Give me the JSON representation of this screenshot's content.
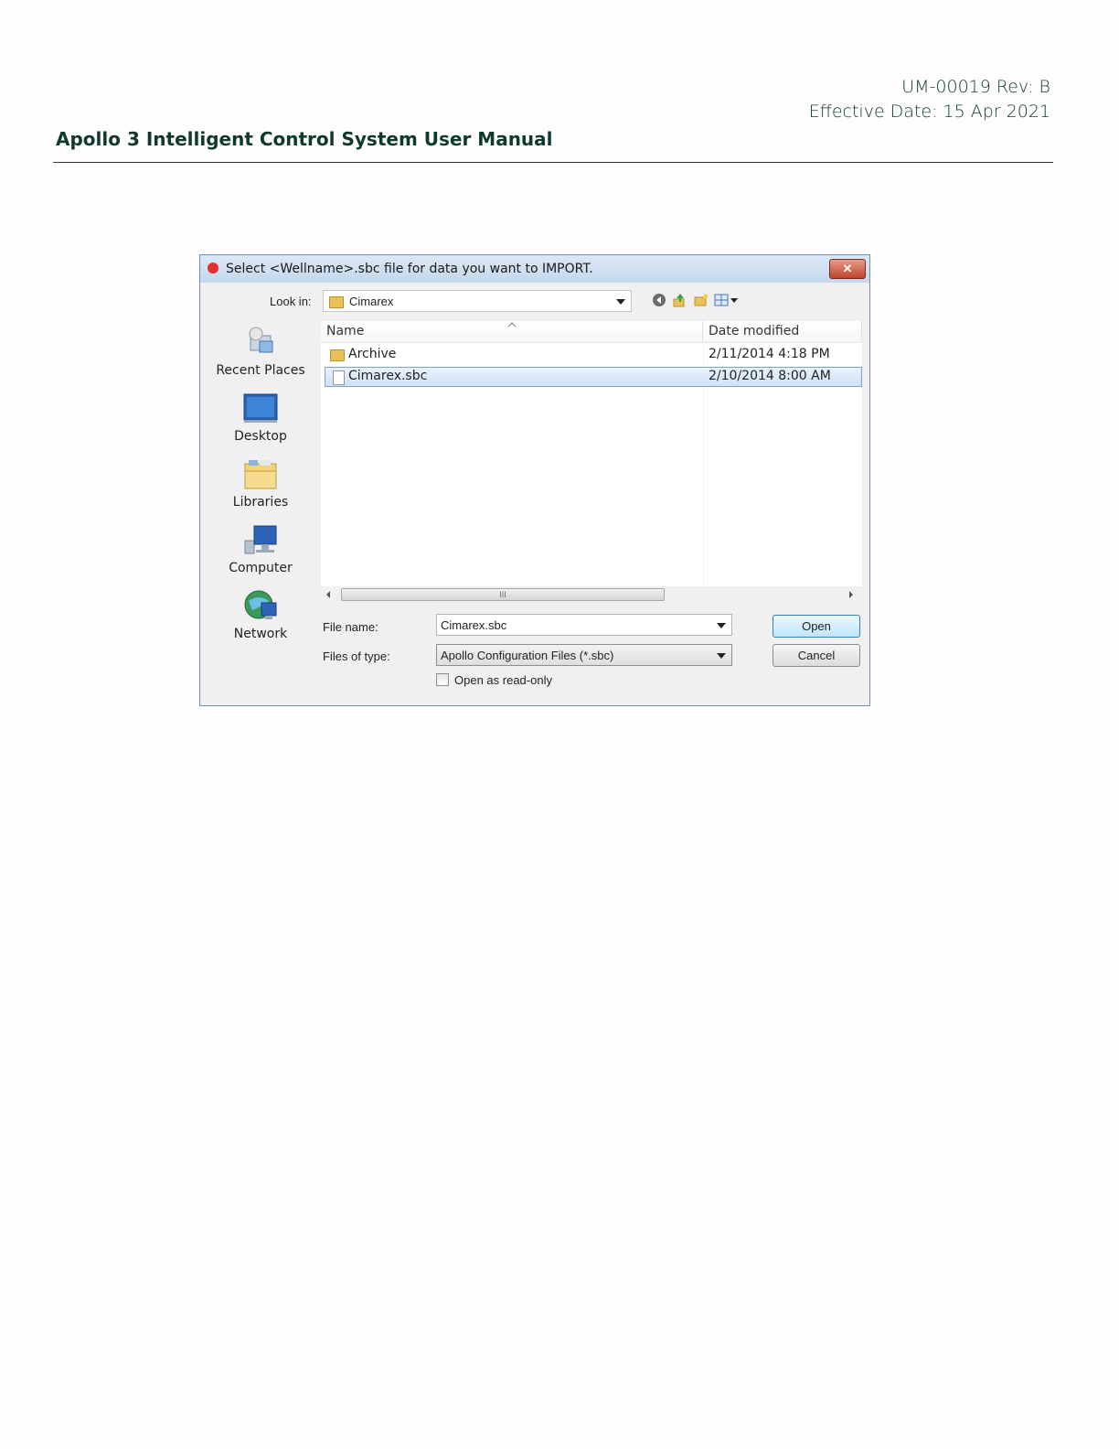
{
  "document": {
    "doc_number": "UM-00019  Rev:  B",
    "effective_date": "Effective Date: 15 Apr 2021",
    "manual_title": "Apollo 3 Intelligent Control System User Manual"
  },
  "dialog": {
    "title": "Select <Wellname>.sbc file for data you want to IMPORT.",
    "close_label": "✕",
    "look_in_label": "Look in:",
    "look_in_value": "Cimarex",
    "toolbar_icons": [
      "back-icon",
      "up-folder-icon",
      "new-folder-icon",
      "view-menu-icon"
    ],
    "places": [
      {
        "label": "Recent Places",
        "icon": "recent-places-icon"
      },
      {
        "label": "Desktop",
        "icon": "desktop-icon"
      },
      {
        "label": "Libraries",
        "icon": "libraries-icon"
      },
      {
        "label": "Computer",
        "icon": "computer-icon"
      },
      {
        "label": "Network",
        "icon": "network-icon"
      }
    ],
    "columns": {
      "name": "Name",
      "date": "Date modified"
    },
    "files": [
      {
        "name": "Archive",
        "date": "2/11/2014 4:18 PM",
        "type": "folder"
      },
      {
        "name": "Cimarex.sbc",
        "date": "2/10/2014 8:00 AM",
        "type": "file"
      }
    ],
    "scroll_grip": "III",
    "file_name_label": "File name:",
    "file_name_value": "Cimarex.sbc",
    "file_type_label": "Files of type:",
    "file_type_value": "Apollo Configuration Files (*.sbc)",
    "open_label": "Open",
    "cancel_label": "Cancel",
    "readonly_label": "Open as read-only"
  }
}
